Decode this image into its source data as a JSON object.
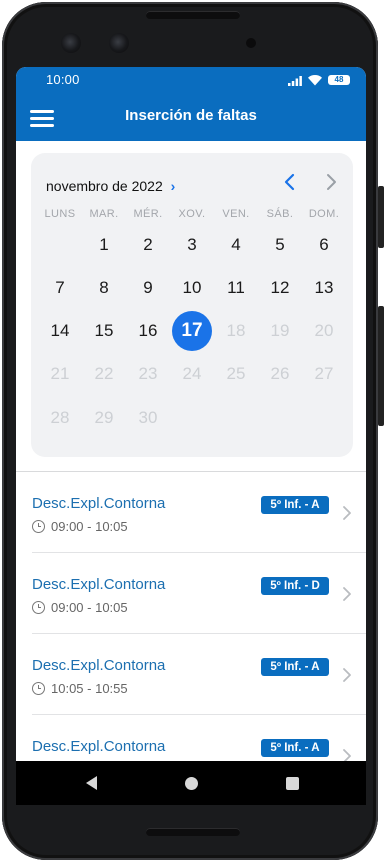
{
  "status_bar": {
    "time": "10:00",
    "battery": "48"
  },
  "app_bar": {
    "title": "Inserción de faltas"
  },
  "calendar": {
    "month_label": "novembro de 2022",
    "weekdays": [
      "LUNS",
      "MAR.",
      "MÉR.",
      "XOV.",
      "VEN.",
      "SÁB.",
      "DOM."
    ],
    "selected_day": "17",
    "weeks": [
      [
        "",
        "1",
        "2",
        "3",
        "4",
        "5",
        "6"
      ],
      [
        "7",
        "8",
        "9",
        "10",
        "11",
        "12",
        "13"
      ],
      [
        "14",
        "15",
        "16",
        "17",
        "18",
        "19",
        "20"
      ],
      [
        "21",
        "22",
        "23",
        "24",
        "25",
        "26",
        "27"
      ],
      [
        "28",
        "29",
        "30",
        "",
        "",
        "",
        ""
      ]
    ]
  },
  "sessions": [
    {
      "subject": "Desc.Expl.Contorna",
      "time": "09:00 - 10:05",
      "group": "5º Inf. - A"
    },
    {
      "subject": "Desc.Expl.Contorna",
      "time": "09:00 - 10:05",
      "group": "5º Inf. - D"
    },
    {
      "subject": "Desc.Expl.Contorna",
      "time": "10:05 - 10:55",
      "group": "5º Inf. - A"
    },
    {
      "subject": "Desc.Expl.Contorna",
      "time": "",
      "group": "5º Inf. - A"
    }
  ],
  "colors": {
    "primary": "#0a6dbf",
    "accent": "#1a73e8",
    "subject_text": "#1c6fb0"
  },
  "icons": [
    "menu-icon",
    "chevron-right-icon",
    "chevron-left-icon",
    "clock-icon",
    "back-icon",
    "home-icon",
    "recents-icon",
    "signal-icon",
    "wifi-icon",
    "battery-icon"
  ]
}
